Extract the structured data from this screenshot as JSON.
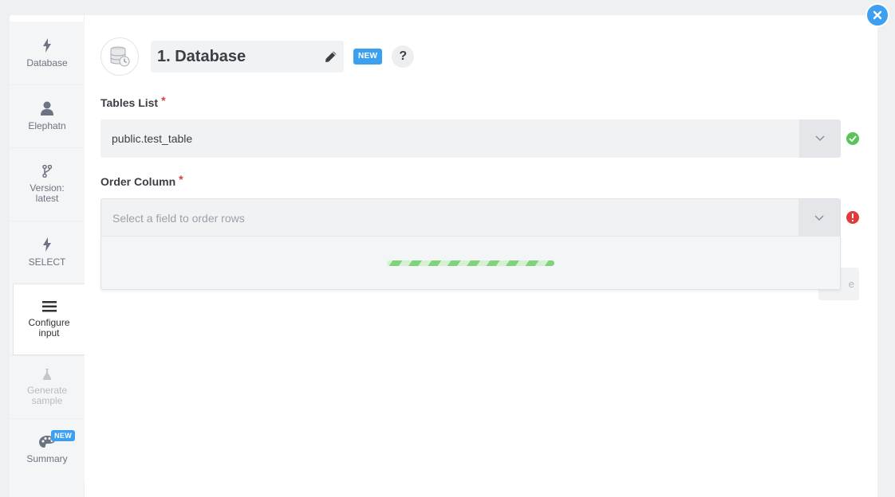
{
  "sidebar": {
    "items": [
      {
        "label": "Database",
        "icon": "bolt-icon",
        "state": "normal"
      },
      {
        "label": "Elephatn",
        "icon": "user-icon",
        "state": "normal"
      },
      {
        "label": "Version:\nlatest",
        "label_line1": "Version:",
        "label_line2": "latest",
        "icon": "branch-icon",
        "state": "normal"
      },
      {
        "label": "SELECT",
        "icon": "bolt-icon",
        "state": "normal"
      },
      {
        "label_line1": "Configure",
        "label_line2": "input",
        "icon": "menu-icon",
        "state": "active"
      },
      {
        "label_line1": "Generate",
        "label_line2": "sample",
        "icon": "flask-icon",
        "state": "disabled"
      },
      {
        "label": "Summary",
        "icon": "palette-icon",
        "state": "normal",
        "badge": "NEW"
      }
    ]
  },
  "header": {
    "title": "1. Database",
    "badge": "NEW",
    "help": "?"
  },
  "fields": {
    "tables_list": {
      "label": "Tables List",
      "required": "*",
      "value": "public.test_table",
      "status": "valid"
    },
    "order_column": {
      "label": "Order Column",
      "required": "*",
      "placeholder": "Select a field to order rows",
      "status": "error",
      "dropdown_state": "loading"
    }
  },
  "hidden_button_text": "e",
  "colors": {
    "accent": "#3d9ff0",
    "success": "#5cc35a",
    "error": "#e23a3a",
    "loader": "#7fd37a"
  }
}
